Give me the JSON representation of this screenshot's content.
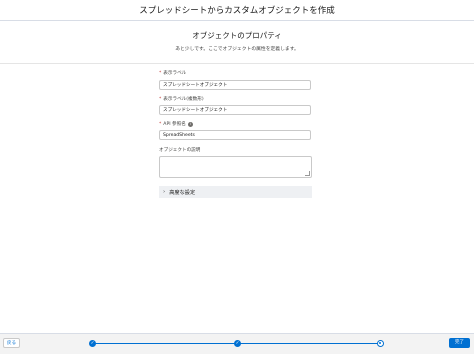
{
  "header": {
    "title": "スプレッドシートからカスタムオブジェクトを作成"
  },
  "section": {
    "title": "オブジェクトのプロパティ",
    "subtitle": "あと少しです。ここでオブジェクトの属性を定義します。"
  },
  "form": {
    "required_marker": "*",
    "fields": [
      {
        "label": "表示ラベル",
        "required": true,
        "value": "スプレッドシートオブジェクト"
      },
      {
        "label": "表示ラベル(複数形)",
        "required": true,
        "value": "スプレッドシートオブジェクト"
      },
      {
        "label": "API 参照名",
        "required": true,
        "value": "SpreadSheets",
        "info_icon": "info-icon",
        "info_glyph": "i"
      },
      {
        "label": "オブジェクトの説明",
        "required": false,
        "value": ""
      }
    ],
    "advanced": {
      "label": "高度な設定",
      "icon": "chevron-right-icon",
      "glyph": "›",
      "expanded": false
    }
  },
  "footer": {
    "back_label": "戻る",
    "done_label": "完了",
    "steps": [
      {
        "state": "complete",
        "icon": "check-icon",
        "glyph": "✓"
      },
      {
        "state": "complete",
        "icon": "check-icon",
        "glyph": "✓"
      },
      {
        "state": "current",
        "icon": "current-step-icon",
        "glyph": ""
      }
    ],
    "accent_color": "#0070d2"
  }
}
